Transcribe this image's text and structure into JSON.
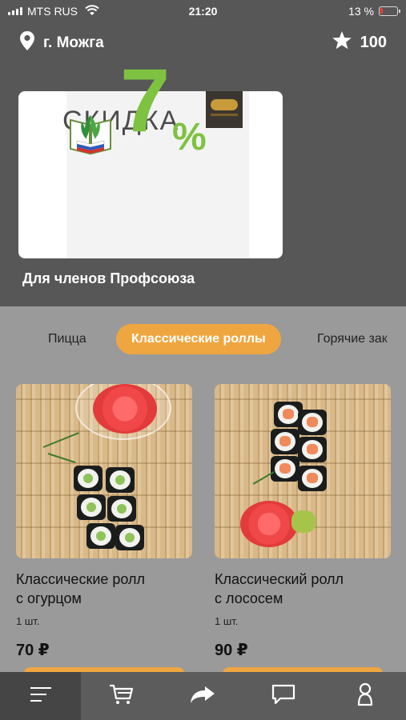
{
  "status_bar": {
    "carrier": "MTS RUS",
    "time": "21:20",
    "battery": "13 %"
  },
  "header": {
    "city": "г. Можга",
    "points": "100"
  },
  "promo": {
    "word": "СКИДКА",
    "number": "7",
    "percent": "%",
    "caption": "Для членов Профсоюза"
  },
  "tabs": [
    {
      "label": "Пицца"
    },
    {
      "label": "Классические роллы"
    },
    {
      "label": "Горячие зак"
    }
  ],
  "products": [
    {
      "title_line1": "Классические ролл",
      "title_line2": "с огурцом",
      "qty": "1 шт.",
      "price": "70 ₽"
    },
    {
      "title_line1": "Классический ролл",
      "title_line2": "с лососем",
      "qty": "1 шт.",
      "price": "90 ₽"
    }
  ],
  "nav": [
    "menu-icon",
    "cart-icon",
    "share-icon",
    "chat-icon",
    "profile-icon"
  ],
  "colors": {
    "accent": "#f0a640",
    "promo_green": "#7ec242",
    "header_bg": "#575757",
    "body_bg": "#9a9a9a"
  }
}
